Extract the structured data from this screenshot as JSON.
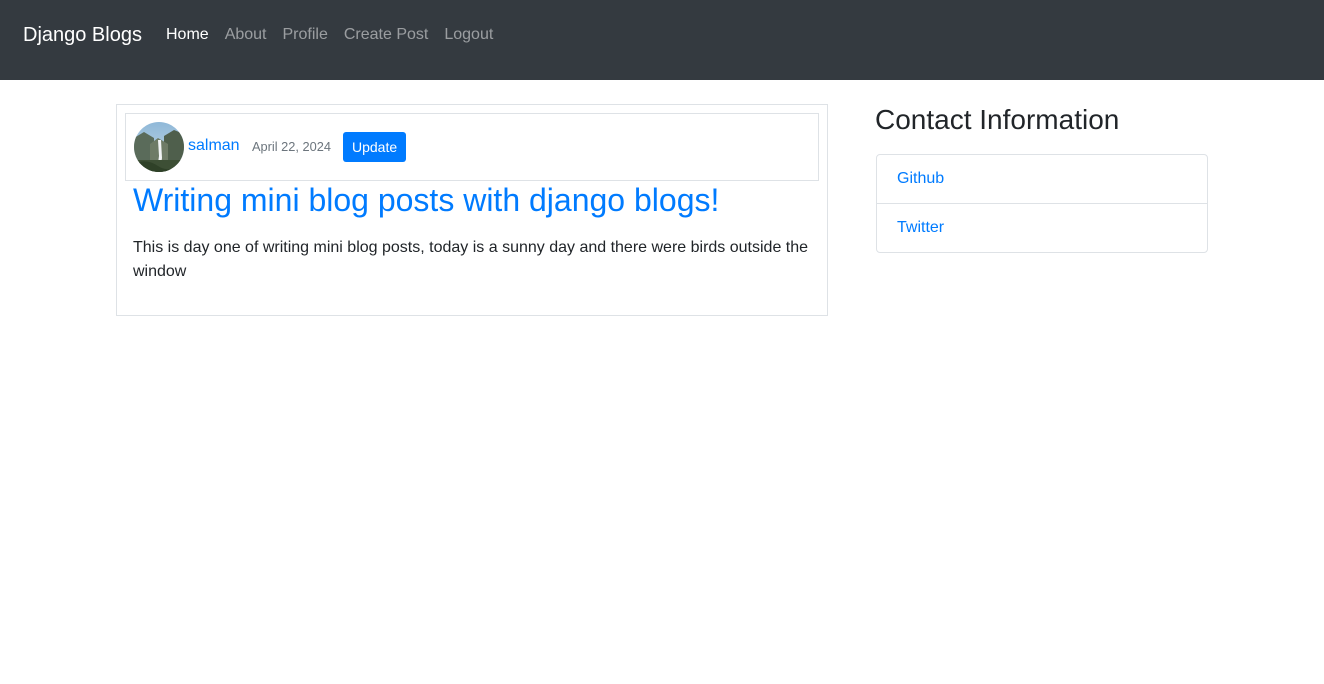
{
  "navbar": {
    "brand": "Django Blogs",
    "links": [
      {
        "label": "Home",
        "active": true
      },
      {
        "label": "About",
        "active": false
      },
      {
        "label": "Profile",
        "active": false
      },
      {
        "label": "Create Post",
        "active": false
      },
      {
        "label": "Logout",
        "active": false
      }
    ]
  },
  "post": {
    "author": "salman",
    "date": "April 22, 2024",
    "update_label": "Update",
    "title": "Writing mini blog posts with django blogs!",
    "content": "This is day one of writing mini blog posts, today is a sunny day and there were birds outside the window"
  },
  "sidebar": {
    "heading": "Contact Information",
    "links": [
      {
        "label": "Github"
      },
      {
        "label": "Twitter"
      }
    ]
  },
  "colors": {
    "navbar_bg": "#343a40",
    "link": "#007bff",
    "button_bg": "#007bff",
    "muted": "#6c757d",
    "border": "#dee2e6"
  }
}
